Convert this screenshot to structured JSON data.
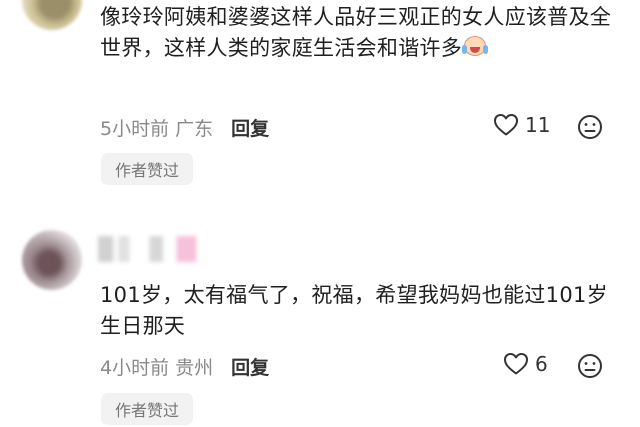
{
  "comments": [
    {
      "text": "像玲玲阿姨和婆婆这样人品好三观正的女人应该普及全世界，这样人类的家庭生活会和谐许多",
      "emoji_icon": "crying-laughing-emoji-icon",
      "time": "5小时前",
      "location": "广东",
      "reply_label": "回复",
      "likes": "11",
      "author_liked_badge": "作者赞过"
    },
    {
      "text": "101岁，太有福气了，祝福，希望我妈妈也能过101岁生日那天",
      "time": "4小时前",
      "location": "贵州",
      "reply_label": "回复",
      "likes": "6",
      "author_liked_badge": "作者赞过"
    }
  ],
  "colors": {
    "text": "#1f1f1f",
    "meta": "#8a8a8a",
    "badge_bg": "#f2f2f2",
    "badge_text": "#777777"
  }
}
